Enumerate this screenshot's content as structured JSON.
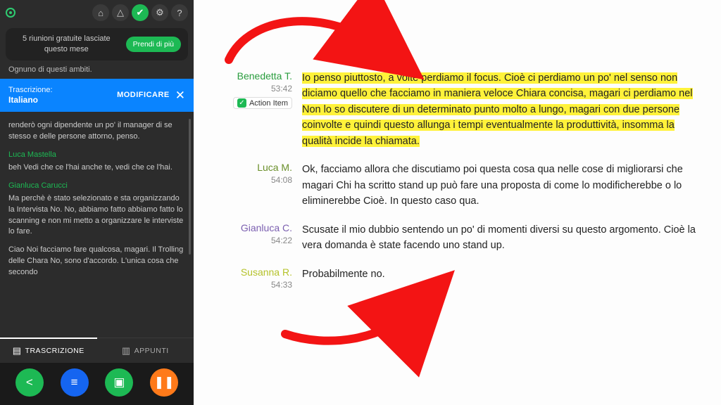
{
  "sidebar": {
    "promo_text": "5 riunioni gratuite lasciate questo mese",
    "promo_button": "Prendi di più",
    "cutoff_text": "Ognuno di questi ambiti.",
    "banner": {
      "label": "Trascrizione:",
      "language": "Italiano",
      "modify": "MODIFICARE"
    },
    "transcript": [
      {
        "speaker": "",
        "text": "renderò ogni dipendente un po' il manager di se stesso e delle persone attorno, penso."
      },
      {
        "speaker": "Luca Mastella",
        "text": "beh Vedi che ce l'hai anche te, vedi che ce l'hai."
      },
      {
        "speaker": "Gianluca Carucci",
        "text": "Ma perchè è stato selezionato e sta organizzando la Intervista No. No, abbiamo fatto abbiamo fatto lo scanning e non mi metto a organizzare le interviste lo fare."
      },
      {
        "speaker": "",
        "text": "Ciao Noi facciamo fare qualcosa, magari. Il Trolling delle Chara No, sono d'accordo. L'unica cosa che secondo"
      }
    ],
    "tabs": {
      "transcription": "TRASCRIZIONE",
      "notes": "APPUNTI"
    }
  },
  "main": {
    "entries": [
      {
        "name": "Benedetta T.",
        "colorClass": "c0",
        "time": "53:42",
        "action_item": "Action Item",
        "highlighted": true,
        "text": "Io penso piuttosto, a volte perdiamo il focus. Cioè ci perdiamo un po' nel senso non diciamo quello che facciamo in maniera veloce Chiara concisa, magari ci perdiamo nel Non lo so discutere di un determinato punto molto a lungo, magari con due persone coinvolte e quindi questo allunga i tempi eventualmente la produttività, insomma la qualità incide la chiamata."
      },
      {
        "name": "Luca M.",
        "colorClass": "c1",
        "time": "54:08",
        "text": "Ok, facciamo allora che discutiamo poi questa cosa qua nelle cose di migliorarsi che magari Chi ha scritto stand up può fare una proposta di come lo modificherebbe o lo eliminerebbe Cioè. In questo caso qua."
      },
      {
        "name": "Gianluca C.",
        "colorClass": "c2",
        "time": "54:22",
        "text": "Scusate il mio dubbio sentendo un po' di momenti diversi su questo argomento. Cioè la vera domanda è state facendo uno stand up."
      },
      {
        "name": "Susanna R.",
        "colorClass": "c3",
        "time": "54:33",
        "text": "Probabilmente no."
      }
    ]
  }
}
